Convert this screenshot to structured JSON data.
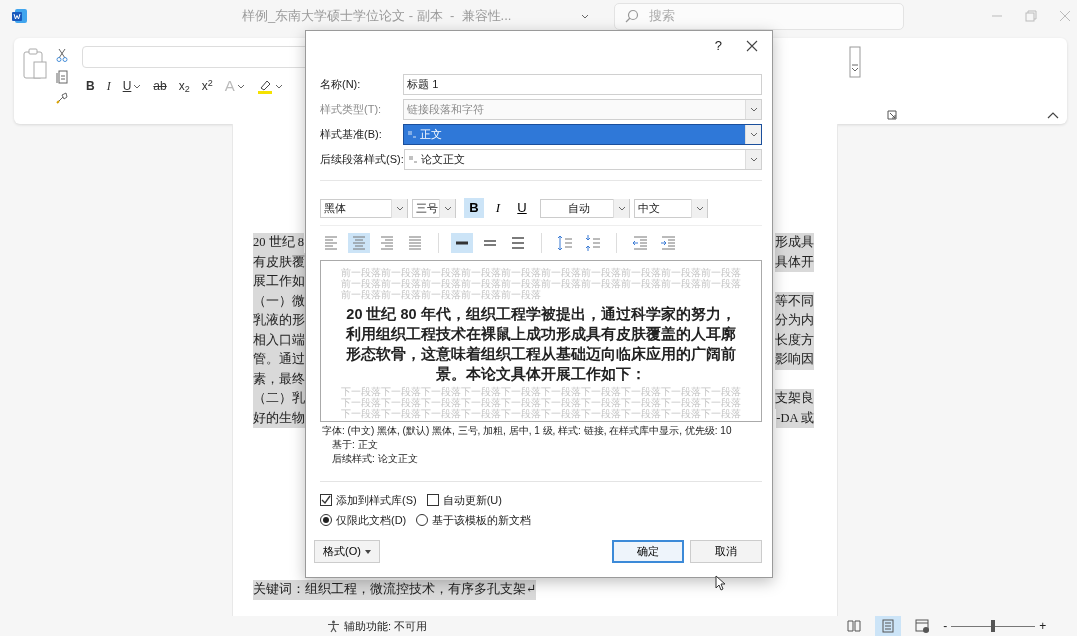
{
  "window": {
    "title": "样例_东南大学硕士学位论文 - 副本  -  兼容性...",
    "search_placeholder": "搜索"
  },
  "ribbon": {
    "font_buttons": [
      {
        "kind": "bold",
        "label": "B",
        "dropdown": false
      },
      {
        "kind": "italic",
        "label": "I",
        "dropdown": false
      },
      {
        "kind": "underline",
        "label": "U",
        "dropdown": true
      },
      {
        "kind": "strike",
        "label": "ab",
        "dropdown": false
      },
      {
        "kind": "sub",
        "label": "x$_{2}$",
        "dropdown": false
      },
      {
        "kind": "sup",
        "label": "x$^{2}$",
        "dropdown": false
      },
      {
        "kind": "effects",
        "label": "A",
        "dropdown": true
      },
      {
        "kind": "highlight",
        "dropdown": true
      }
    ]
  },
  "document": {
    "lines": [
      {
        "left": "20 世纪 8",
        "right": "形成具"
      },
      {
        "left": "有皮肤覆",
        "right": "具体开"
      },
      {
        "left": "展工作如"
      },
      {
        "left": "（一）微",
        "right": "等不同"
      },
      {
        "left": "乳液的形",
        "right": "分为内"
      },
      {
        "left": "相入口端",
        "right": "长度方"
      },
      {
        "left": "管。通过",
        "right": "影响因"
      },
      {
        "left": "素，最终"
      },
      {
        "left": "（二）乳",
        "right": "支架良"
      },
      {
        "left": "好的生物",
        "right": "-DA 或"
      }
    ],
    "keywords": "关键词：组织工程，微流控技术，有序多孔支架↵"
  },
  "dialog": {
    "help": "?",
    "fields": [
      {
        "label": "名称(N):",
        "value": "标题 1",
        "kind": "text",
        "disabled": false,
        "focused": false
      },
      {
        "label": "样式类型(T):",
        "value": "链接段落和字符",
        "kind": "select",
        "disabled": true,
        "focused": false
      },
      {
        "label": "样式基准(B):",
        "value": "正文",
        "kind": "style-select",
        "disabled": false,
        "focused": true
      },
      {
        "label": "后续段落样式(S):",
        "value": "论文正文",
        "kind": "style-select",
        "disabled": false,
        "focused": false
      }
    ],
    "font_bar": {
      "font": "黑体",
      "size": "三号",
      "toggles": [
        {
          "kind": "bold",
          "label": "B",
          "on": true
        },
        {
          "kind": "italic",
          "label": "I",
          "on": false
        },
        {
          "kind": "underline",
          "label": "U",
          "on": false
        }
      ],
      "text_color": "自动",
      "script": "中文"
    },
    "paragraph_bar": {
      "alignment": [
        {
          "kind": "left",
          "selected": false
        },
        {
          "kind": "center",
          "selected": true
        },
        {
          "kind": "right",
          "selected": false
        },
        {
          "kind": "justify",
          "selected": false
        }
      ],
      "line_spacing": [
        {
          "kind": "single",
          "selected": true
        },
        {
          "kind": "one-half",
          "selected": false
        },
        {
          "kind": "double",
          "selected": false
        }
      ],
      "spacing_actions": [
        {
          "kind": "space-more"
        },
        {
          "kind": "space-less"
        }
      ],
      "indent_actions": [
        {
          "kind": "outdent"
        },
        {
          "kind": "indent"
        }
      ]
    },
    "preview": {
      "before": "前一段落前一段落前一段落前一段落前一段落前一段落前一段落前一段落前一段落前一段落前一段落前一段落前一段落前一段落前一段落前一段落前一段落前一段落前一段落前一段落前一段落前一段落前一段落前一段落前一段落",
      "sample": "20 世纪 80 年代，组织工程学被提出，通过科学家的努力，利用组织工程技术在裸鼠上成功形成具有皮肤覆盖的人耳廓形态软骨，这意味着组织工程从基础迈向临床应用的广阔前景。本论文具体开展工作如下：",
      "after": "下一段落下一段落下一段落下一段落下一段落下一段落下一段落下一段落下一段落下一段落下一段落下一段落下一段落下一段落下一段落下一段落下一段落下一段落下一段落下一段落下一段落下一段落下一段落下一段落下一段落下一段落下一段落下一段落下一段落下一段落"
    },
    "description": [
      "字体: (中文) 黑体, (默认) 黑体, 三号, 加粗, 居中, 1 级, 样式: 链接, 在样式库中显示, 优先级: 10",
      "基于: 正文",
      "后续样式: 论文正文"
    ],
    "checkboxes": [
      {
        "label": "添加到样式库(S)",
        "checked": true
      },
      {
        "label": "自动更新(U)",
        "checked": false
      }
    ],
    "radios": [
      {
        "label": "仅限此文档(D)",
        "selected": true
      },
      {
        "label": "基于该模板的新文档",
        "selected": false
      }
    ],
    "buttons": [
      {
        "label": "格式(O)",
        "kind": "menu"
      },
      {
        "label": "确定",
        "kind": "default"
      },
      {
        "label": "取消",
        "kind": "plain"
      }
    ]
  },
  "status_bar": {
    "accessibility": "辅助功能: 不可用",
    "views": [
      {
        "kind": "read",
        "selected": false
      },
      {
        "kind": "print",
        "selected": true
      },
      {
        "kind": "web",
        "selected": false
      }
    ],
    "zoom": {
      "minus": "-",
      "plus": "+",
      "level": 0.5
    }
  }
}
